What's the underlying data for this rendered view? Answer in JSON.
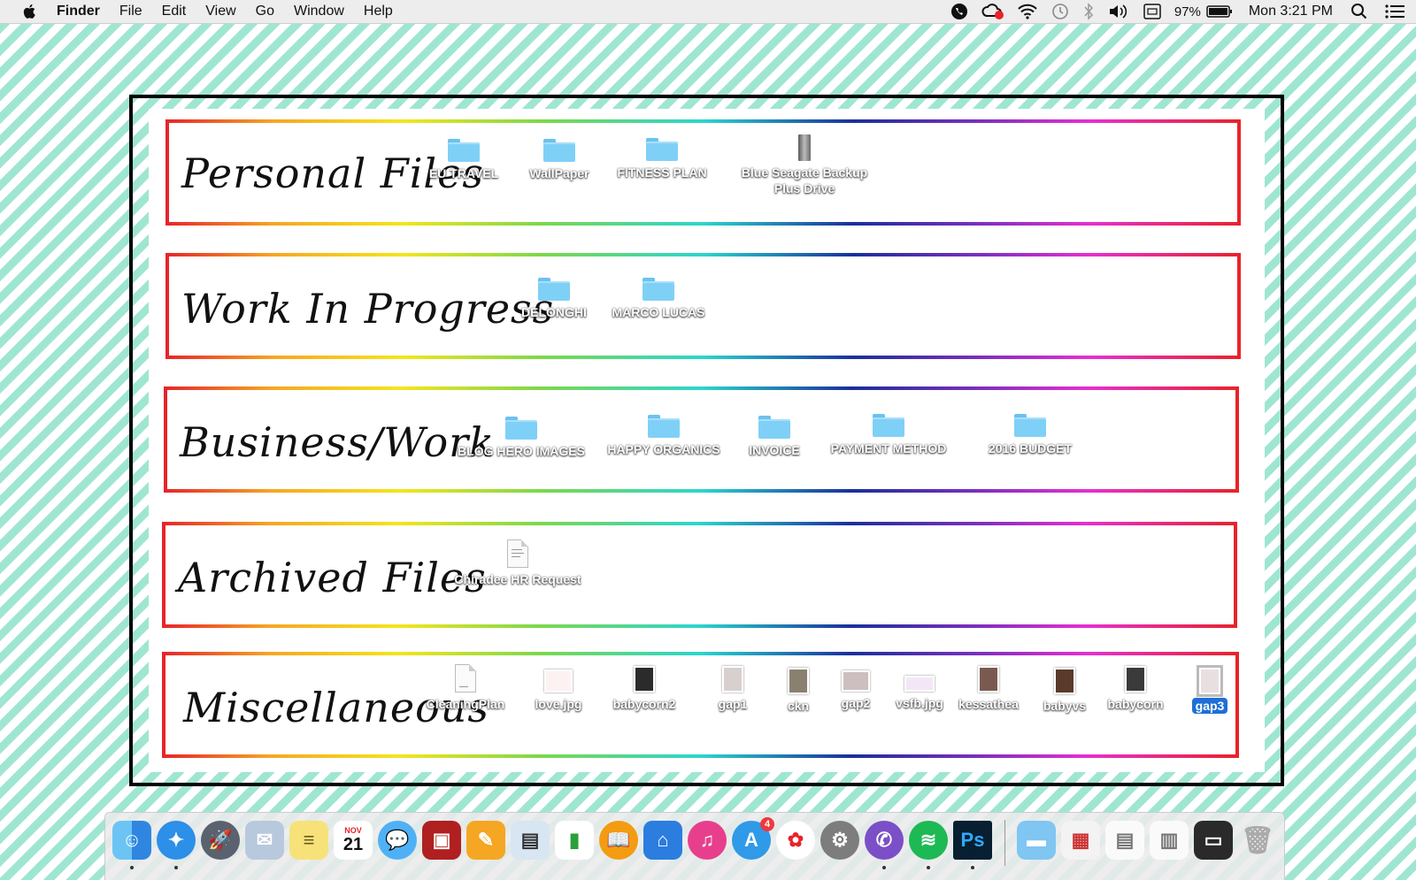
{
  "menubar": {
    "app_name": "Finder",
    "menus": [
      "File",
      "Edit",
      "View",
      "Go",
      "Window",
      "Help"
    ],
    "battery_percent": "97%",
    "clock": "Mon 3:21 PM",
    "status_icons": [
      "viber-icon",
      "creative-cloud-icon",
      "wifi-icon",
      "time-machine-icon",
      "bluetooth-icon",
      "volume-icon",
      "keyboard-icon",
      "battery-icon",
      "spotlight-icon",
      "notification-center-icon"
    ]
  },
  "sections": [
    {
      "title": "Personal Files",
      "items": [
        {
          "label": "EU TRAVEL",
          "type": "folder"
        },
        {
          "label": "WallPaper",
          "type": "folder"
        },
        {
          "label": "FITNESS PLAN",
          "type": "folder"
        },
        {
          "label": "Blue Seagate Backup Plus Drive",
          "type": "drive"
        }
      ]
    },
    {
      "title": "Work In Progress",
      "items": [
        {
          "label": "DELONGHI",
          "type": "folder"
        },
        {
          "label": "MARCO LUCAS",
          "type": "folder"
        }
      ]
    },
    {
      "title": "Business/Work",
      "items": [
        {
          "label": "BLOG HERO IMAGES",
          "type": "folder"
        },
        {
          "label": "HAPPY ORGANICS",
          "type": "folder"
        },
        {
          "label": "INVOICE",
          "type": "folder"
        },
        {
          "label": "PAYMENT METHOD",
          "type": "folder"
        },
        {
          "label": "2016 BUDGET",
          "type": "folder"
        }
      ]
    },
    {
      "title": "Archived Files",
      "items": [
        {
          "label": "Chiradee HR Request",
          "type": "document"
        }
      ]
    },
    {
      "title": "Miscellaneous",
      "items": [
        {
          "label": "CleaningPlan",
          "type": "document"
        },
        {
          "label": "love.jpg",
          "type": "image"
        },
        {
          "label": "babycorn2",
          "type": "image"
        },
        {
          "label": "gap1",
          "type": "image"
        },
        {
          "label": "ckn",
          "type": "image"
        },
        {
          "label": "gap2",
          "type": "image"
        },
        {
          "label": "vsfb.jpg",
          "type": "image"
        },
        {
          "label": "kessathea",
          "type": "image"
        },
        {
          "label": "babyvs",
          "type": "image"
        },
        {
          "label": "babycorn",
          "type": "image"
        },
        {
          "label": "gap3",
          "type": "image",
          "selected": true
        }
      ]
    }
  ],
  "dock": {
    "apps": [
      "finder-icon",
      "safari-icon",
      "launchpad-icon",
      "mail-icon",
      "notes-icon",
      "calendar-icon",
      "messages-icon",
      "photo-booth-icon",
      "pages-icon",
      "preview-icon",
      "numbers-icon",
      "ibooks-icon",
      "keynote-icon",
      "itunes-icon",
      "app-store-icon",
      "photos-icon",
      "system-preferences-icon",
      "viber-icon",
      "spotify-icon",
      "photoshop-icon"
    ],
    "calendar_month": "NOV",
    "calendar_day": "21",
    "app_store_badge": "4",
    "photoshop_label": "Ps",
    "stack_items": [
      "downloads-folder-icon",
      "screenshot-stack-icon",
      "document-stack-icon",
      "document-stack-icon",
      "photoshop-window-icon",
      "trash-icon"
    ]
  },
  "colors": {
    "stripe": "#9fe6d2",
    "section_border": "#e8232b",
    "selection": "#1f6fd6"
  }
}
